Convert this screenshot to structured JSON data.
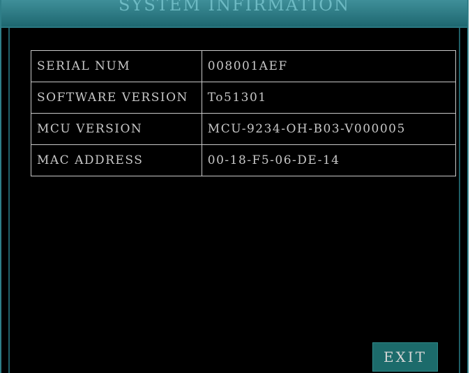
{
  "window": {
    "title": "SYSTEM INFIRMATION"
  },
  "info": {
    "rows": [
      {
        "label": "SERIAL NUM",
        "value": "008001AEF"
      },
      {
        "label": "SOFTWARE VERSION",
        "value": "To51301"
      },
      {
        "label": "MCU VERSION",
        "value": "MCU-9234-OH-B03-V000005"
      },
      {
        "label": "MAC ADDRESS",
        "value": "00-18-F5-06-DE-14"
      }
    ]
  },
  "footer": {
    "exit_label": "EXIT"
  },
  "colors": {
    "title_bar": "#2f7e88",
    "background": "#000000",
    "button": "#1c6b6b"
  }
}
